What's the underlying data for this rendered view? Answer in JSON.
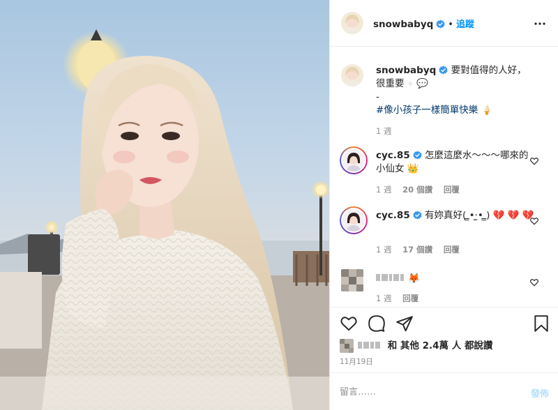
{
  "post": {
    "author": "snowbabyq",
    "follow_label": "追蹤",
    "separator": "•",
    "more_icon": "more-dots-icon"
  },
  "caption": {
    "username": "snowbabyq",
    "text": "要對值得的人好，很重要",
    "dash": "-",
    "hashtag": "#像小孩子一樣簡單快樂",
    "time": "1 週"
  },
  "comments": [
    {
      "username": "cyc.85",
      "text": "怎麼這麼水～～～哪來的小仙女",
      "time": "1 週",
      "likes": "20 個讚",
      "reply": "回覆"
    },
    {
      "username": "cyc.85",
      "text": "有妳真好( ̳•·̫• ̳)",
      "time": "1 週",
      "likes": "17 個讚",
      "reply": "回覆"
    },
    {
      "username": "",
      "text": "",
      "time": "1 週",
      "reply": "回覆"
    }
  ],
  "likes_line": {
    "prefix": "和",
    "others": "其他 2.4萬 人",
    "suffix": "都說讚"
  },
  "date": "11月19日",
  "add_comment": {
    "placeholder": "留言……",
    "post_label": "發佈"
  },
  "colors": {
    "accent": "#0095f6",
    "verified": "#3897f0",
    "heart": "#ed4956"
  }
}
